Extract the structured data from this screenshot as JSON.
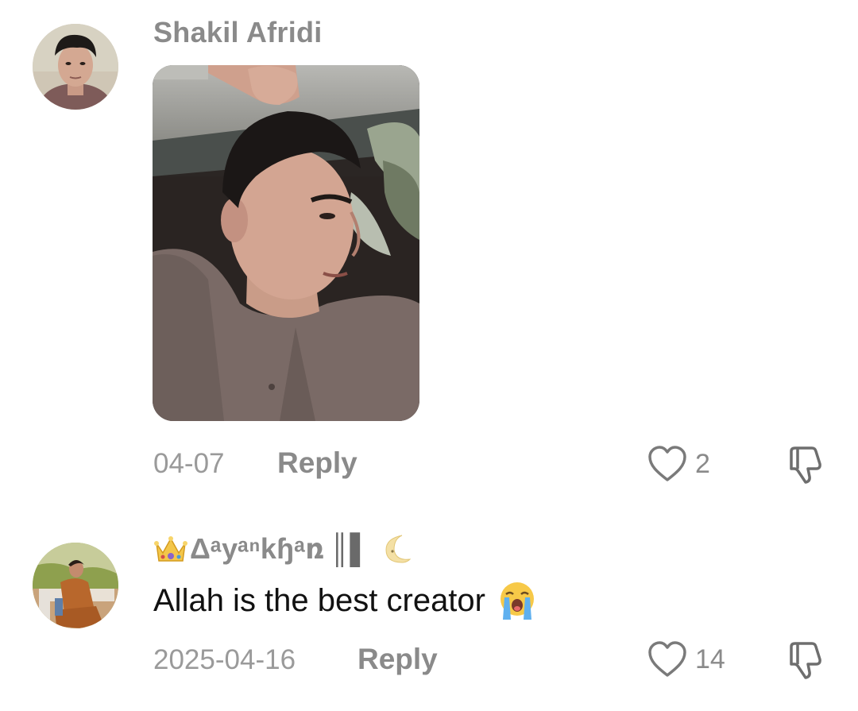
{
  "comments": [
    {
      "username": "Shakil Afridi",
      "date": "04-07",
      "reply_label": "Reply",
      "like_count": "2",
      "has_image": true
    },
    {
      "username": "Δᵃyᵃⁿkɧᵃռ",
      "username_suffix": "║▌",
      "text": "Allah is the best creator",
      "date": "2025-04-16",
      "reply_label": "Reply",
      "like_count": "14"
    }
  ],
  "icons": {
    "like": "heart-outline-icon",
    "dislike": "thumbs-down-outline-icon",
    "crown": "crown-emoji",
    "moon": "crescent-moon-emoji",
    "crying": "loudly-crying-face-emoji"
  },
  "colors": {
    "username": "#8a8a8a",
    "text": "#111111",
    "meta": "#9a9a9a",
    "background": "#ffffff"
  }
}
